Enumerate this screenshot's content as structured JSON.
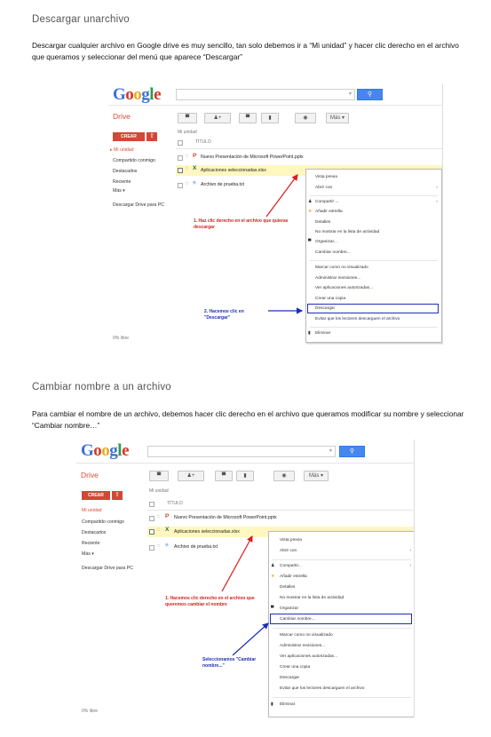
{
  "section1": {
    "heading": "Descargar unarchivo",
    "body": "Descargar cualquier archivo en Google drive es muy sencillo, tan solo debemos ir a “Mi unidad” y hacer clic derecho en el archivo que queramos y seleccionar del menú que aparece “Descargar”"
  },
  "section2": {
    "heading": "Cambiar nombre a un archivo",
    "body": "Para cambiar el nombre de un archivo, debemos hacer clic derecho en el archivo que queramos modificar su nombre y seleccionar “Cambiar nombre…”"
  },
  "drive_ui": {
    "logo": [
      "G",
      "o",
      "o",
      "g",
      "l",
      "e"
    ],
    "search_button_icon": "search-icon",
    "app_name": "Drive",
    "create_label": "CREAR",
    "upload_icon": "upload-icon",
    "more_button": "Más",
    "nav": [
      "Mi unidad",
      "Compartido conmigo",
      "Destacados",
      "Reciente",
      "Más ▾"
    ],
    "desktop_link": "Descargar Drive para PC",
    "breadcrumb": "Mi unidad",
    "column_title": "TÍTULO",
    "files": [
      {
        "icon": "P",
        "icon_color": "#d24726",
        "name": "Nuevo Presentación de Microsoft PowerPoint.pptx"
      },
      {
        "icon": "X",
        "icon_color": "#1e7145",
        "name": "Aplicaciones seleccionadas.xlsx"
      },
      {
        "icon": "≡",
        "icon_color": "#4a86e8",
        "name": "Archivo de prueba.txt"
      }
    ],
    "storage": "0% libre"
  },
  "shot1_menu": [
    "Vista previa",
    "Abrir con",
    "Compartir ...",
    "Añadir estrella",
    "Detalles",
    "No mostrar en la lista de actividad",
    "Organizar...",
    "Cambiar nombre...",
    "Marcar como no visualizado",
    "Administrar revisiones...",
    "Ver aplicaciones autorizadas...",
    "Crear una copia",
    "Descargar",
    "Evitar que los lectores descarguen el archivo",
    "Eliminar"
  ],
  "shot2_menu": [
    "Vista previa",
    "Abrir con",
    "Compartir...",
    "Añadir estrella",
    "Detalles",
    "No mostrar en la lista de actividad",
    "Organizar",
    "Cambiar nombre...",
    "Marcar como no visualizado",
    "Administrar revisiones...",
    "Ver aplicaciones autorizadas...",
    "Crear una copia",
    "Descargar",
    "Evitar que los lectores descarguen el archivo",
    "Eliminar"
  ],
  "shot1_annotations": {
    "step1": "1. Haz clic derecho en el archivo que quieras descargar",
    "step2": "2. Hacemos clic en \"Descargar\""
  },
  "shot2_annotations": {
    "step1": "1. Hacemos clic derecho en el archivo que queremos cambiar el nombre",
    "step2": "Seleccionamos \"Cambiar nombre...\""
  },
  "colors": {
    "annotation_red": "#e01a1a",
    "annotation_blue": "#1d2fb5",
    "brand_red": "#dd4b39",
    "search_blue": "#4787ed",
    "row_highlight": "#fff7bf"
  }
}
